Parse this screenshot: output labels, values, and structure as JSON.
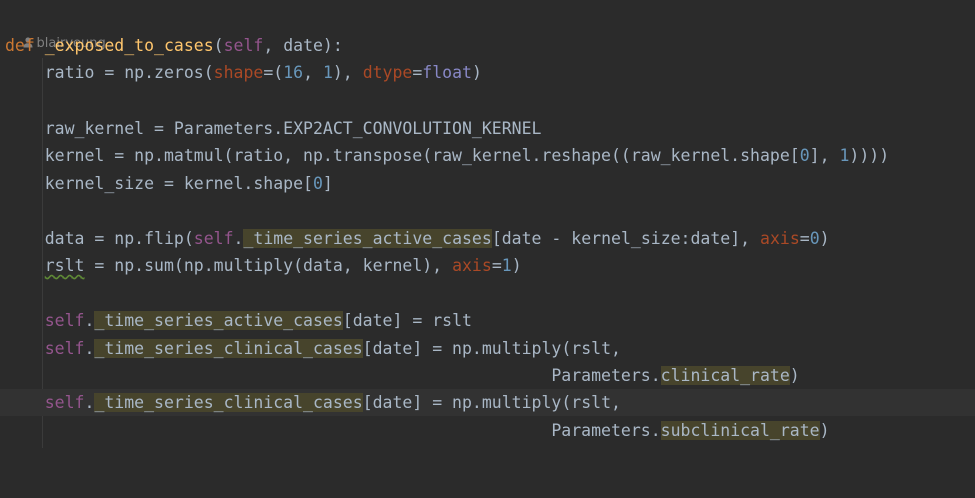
{
  "editor": {
    "author_annotation": "blairyeung",
    "lines": {
      "l1_def": "def",
      "l1_name": "_exposed_to_cases",
      "l1_paren_open": "(",
      "l1_self": "self",
      "l1_rest": ", date):",
      "l2_a": "ratio = np.zeros(",
      "l2_kw1": "shape",
      "l2_b": "=(",
      "l2_num1": "16",
      "l2_c": ", ",
      "l2_num2": "1",
      "l2_d": "), ",
      "l2_kw2": "dtype",
      "l2_e": "=",
      "l2_builtin": "float",
      "l2_f": ")",
      "l4": "raw_kernel = Parameters.EXP2ACT_CONVOLUTION_KERNEL",
      "l5_a": "kernel = np.matmul(ratio, np.transpose(raw_kernel.reshape((raw_kernel.shape[",
      "l5_num1": "0",
      "l5_b": "], ",
      "l5_num2": "1",
      "l5_c": "))))",
      "l6_a": "kernel_size = kernel.shape[",
      "l6_num": "0",
      "l6_b": "]",
      "l8_a": "data = np.flip(",
      "l8_self": "self",
      "l8_dot": ".",
      "l8_attr": "_time_series_active_cases",
      "l8_b": "[date - kernel_size:date], ",
      "l8_kw": "axis",
      "l8_c": "=",
      "l8_num": "0",
      "l8_d": ")",
      "l9_var": "rslt",
      "l9_a": " = np.sum(np.multiply(data, kernel), ",
      "l9_kw": "axis",
      "l9_b": "=",
      "l9_num": "1",
      "l9_c": ")",
      "l11_self": "self",
      "l11_dot": ".",
      "l11_attr": "_time_series_active_cases",
      "l11_b": "[date] = rslt",
      "l12_self": "self",
      "l12_dot": ".",
      "l12_attr": "_time_series_clinical_cases",
      "l12_b": "[date] = np.multiply(rslt,",
      "l13_a": "Parameters.",
      "l13_attr": "clinical_rate",
      "l13_b": ")",
      "l14_self": "self",
      "l14_dot": ".",
      "l14_attr": "_time_series_clinical_cases",
      "l14_b": "[date] = np.multiply(rslt,",
      "l15_a": "Parameters.",
      "l15_attr": "subclinical_rate",
      "l15_b": ")"
    }
  },
  "colors": {
    "background": "#2b2b2b",
    "keyword": "#cc7832",
    "function_name": "#ffc66d",
    "self": "#94558d",
    "number": "#6897bb",
    "kwarg": "#aa4926",
    "highlight": "#47442c"
  },
  "icons": {
    "author": "person-icon"
  }
}
